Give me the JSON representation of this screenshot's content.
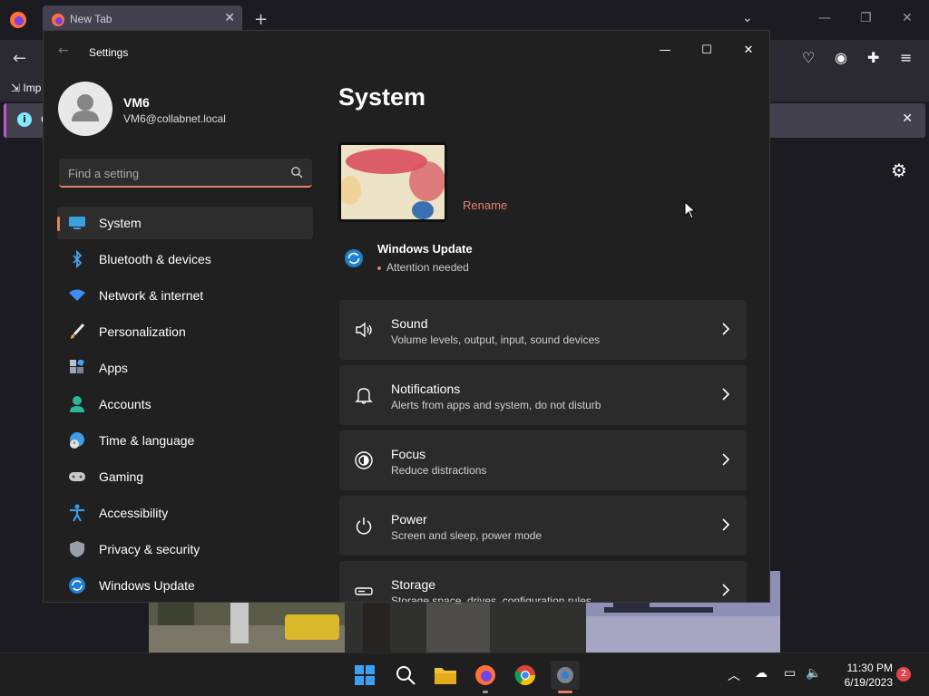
{
  "browser": {
    "tab_title": "New Tab",
    "import_label": "Imp",
    "notify_letter": "C"
  },
  "settings": {
    "window_title": "Settings",
    "profile": {
      "name": "VM6",
      "email": "VM6@collabnet.local"
    },
    "search": {
      "placeholder": "Find a setting"
    },
    "nav": [
      {
        "label": "System",
        "icon": "system-icon",
        "selected": true
      },
      {
        "label": "Bluetooth & devices",
        "icon": "bluetooth-icon"
      },
      {
        "label": "Network & internet",
        "icon": "wifi-icon"
      },
      {
        "label": "Personalization",
        "icon": "brush-icon"
      },
      {
        "label": "Apps",
        "icon": "apps-icon"
      },
      {
        "label": "Accounts",
        "icon": "person-icon"
      },
      {
        "label": "Time & language",
        "icon": "globe-clock-icon"
      },
      {
        "label": "Gaming",
        "icon": "gamepad-icon"
      },
      {
        "label": "Accessibility",
        "icon": "accessibility-icon"
      },
      {
        "label": "Privacy & security",
        "icon": "shield-icon"
      },
      {
        "label": "Windows Update",
        "icon": "update-icon"
      }
    ],
    "page_title": "System",
    "rename_label": "Rename",
    "windows_update": {
      "title": "Windows Update",
      "status": "Attention needed"
    },
    "cards": [
      {
        "title": "Sound",
        "subtitle": "Volume levels, output, input, sound devices",
        "icon": "speaker-icon"
      },
      {
        "title": "Notifications",
        "subtitle": "Alerts from apps and system, do not disturb",
        "icon": "bell-icon"
      },
      {
        "title": "Focus",
        "subtitle": "Reduce distractions",
        "icon": "focus-icon"
      },
      {
        "title": "Power",
        "subtitle": "Screen and sleep, power mode",
        "icon": "power-icon"
      },
      {
        "title": "Storage",
        "subtitle": "Storage space, drives, configuration rules",
        "icon": "storage-icon"
      }
    ],
    "accent_color": "#e3826b"
  },
  "taskbar": {
    "time": "11:30 PM",
    "date": "6/19/2023",
    "notification_count": "2"
  }
}
